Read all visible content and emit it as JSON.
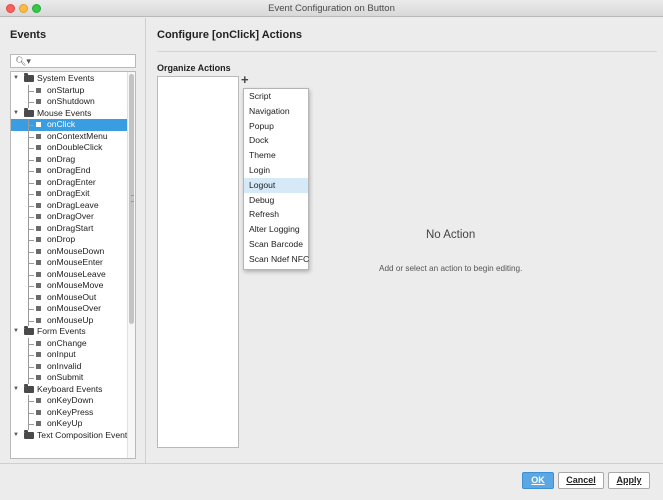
{
  "window": {
    "title": "Event Configuration on Button"
  },
  "left_panel": {
    "title": "Events",
    "search_placeholder": "",
    "tree": [
      {
        "type": "category",
        "label": "System Events"
      },
      {
        "type": "event",
        "label": "onStartup"
      },
      {
        "type": "event",
        "label": "onShutdown"
      },
      {
        "type": "category",
        "label": "Mouse Events"
      },
      {
        "type": "event",
        "label": "onClick",
        "selected": true
      },
      {
        "type": "event",
        "label": "onContextMenu"
      },
      {
        "type": "event",
        "label": "onDoubleClick"
      },
      {
        "type": "event",
        "label": "onDrag"
      },
      {
        "type": "event",
        "label": "onDragEnd"
      },
      {
        "type": "event",
        "label": "onDragEnter"
      },
      {
        "type": "event",
        "label": "onDragExit"
      },
      {
        "type": "event",
        "label": "onDragLeave"
      },
      {
        "type": "event",
        "label": "onDragOver"
      },
      {
        "type": "event",
        "label": "onDragStart"
      },
      {
        "type": "event",
        "label": "onDrop"
      },
      {
        "type": "event",
        "label": "onMouseDown"
      },
      {
        "type": "event",
        "label": "onMouseEnter"
      },
      {
        "type": "event",
        "label": "onMouseLeave"
      },
      {
        "type": "event",
        "label": "onMouseMove"
      },
      {
        "type": "event",
        "label": "onMouseOut"
      },
      {
        "type": "event",
        "label": "onMouseOver"
      },
      {
        "type": "event",
        "label": "onMouseUp"
      },
      {
        "type": "category",
        "label": "Form Events"
      },
      {
        "type": "event",
        "label": "onChange"
      },
      {
        "type": "event",
        "label": "onInput"
      },
      {
        "type": "event",
        "label": "onInvalid"
      },
      {
        "type": "event",
        "label": "onSubmit"
      },
      {
        "type": "category",
        "label": "Keyboard Events"
      },
      {
        "type": "event",
        "label": "onKeyDown"
      },
      {
        "type": "event",
        "label": "onKeyPress"
      },
      {
        "type": "event",
        "label": "onKeyUp"
      },
      {
        "type": "category",
        "label": "Text Composition Events"
      }
    ]
  },
  "main": {
    "title": "Configure [onClick] Actions",
    "organize_label": "Organize Actions",
    "add_icon": "+",
    "add_menu": [
      "Script",
      "Navigation",
      "Popup",
      "Dock",
      "Theme",
      "Login",
      "Logout",
      "Debug",
      "Refresh",
      "Alter Logging",
      "Scan Barcode",
      "Scan Ndef NFC"
    ],
    "hovered_menu_item": "Logout",
    "empty_title": "No Action",
    "empty_hint": "Add or select an action to begin editing."
  },
  "buttons": {
    "ok": "OK",
    "cancel": "Cancel",
    "apply": "Apply"
  },
  "colors": {
    "selection": "#3b9de1",
    "ok_button": "#5aa7e4",
    "menu_hover": "#d6e9f7"
  }
}
